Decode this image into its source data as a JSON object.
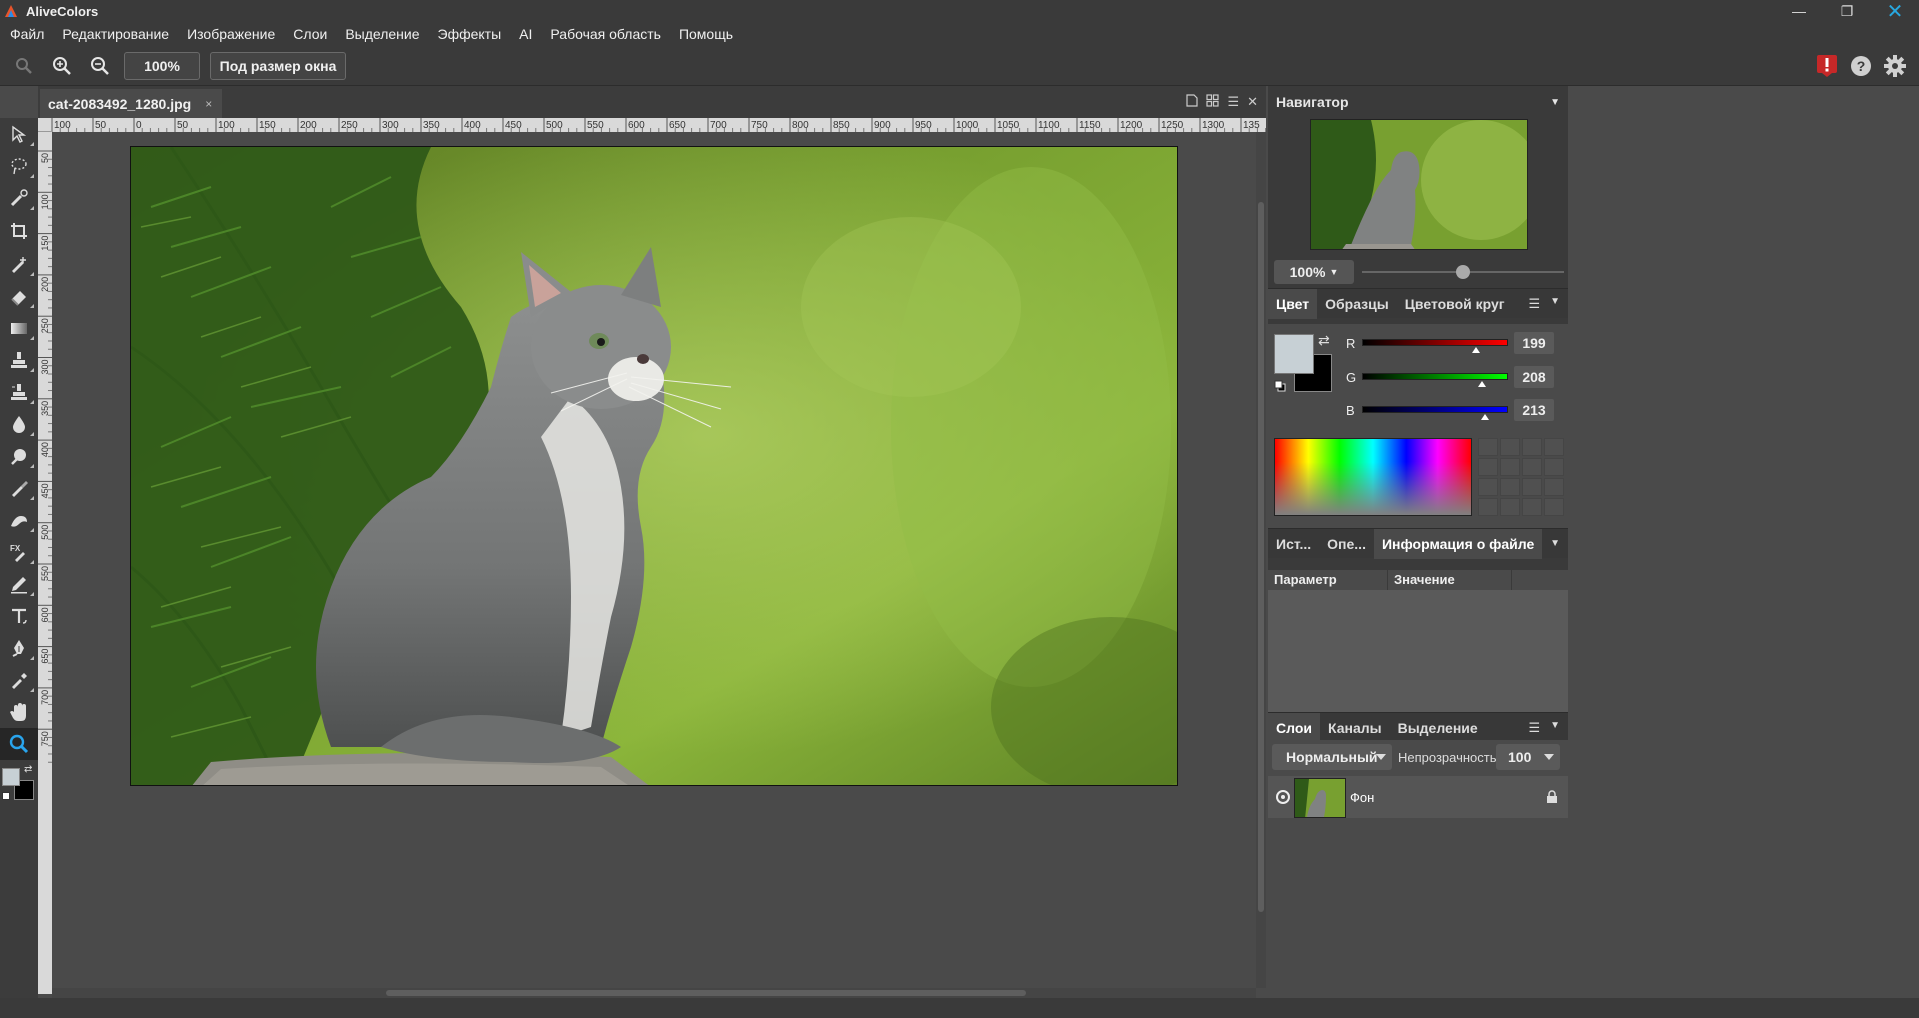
{
  "app": {
    "title": "AliveColors",
    "window_controls": [
      "minimize-icon",
      "restore-icon",
      "close-icon"
    ]
  },
  "menu": [
    "Файл",
    "Редактирование",
    "Изображение",
    "Слои",
    "Выделение",
    "Эффекты",
    "AI",
    "Рабочая область",
    "Помощь"
  ],
  "toolbar": {
    "icons": [
      "zoom-icon",
      "zoom-in-icon",
      "zoom-out-icon"
    ],
    "zoom_value": "100%",
    "fit_button": "Под размер окна",
    "right_icons": [
      "alert-icon",
      "help-icon",
      "settings-icon"
    ]
  },
  "tools": [
    "select-arrow",
    "lasso",
    "magic-brush",
    "crop",
    "brush-plus",
    "eraser",
    "gradient",
    "stamp",
    "clone-stamp",
    "drop",
    "sponge",
    "brush",
    "smudge",
    "fx-brush",
    "pencil",
    "text",
    "pen",
    "eyedropper",
    "hand",
    "zoom"
  ],
  "document": {
    "tab_name": "cat-2083492_1280.jpg",
    "tab_close": "×"
  },
  "rulers": {
    "top": [
      "100",
      "50",
      "0",
      "50",
      "100",
      "150",
      "200",
      "250",
      "300",
      "350",
      "400",
      "450",
      "500",
      "550",
      "600",
      "650",
      "700",
      "750",
      "800",
      "850",
      "900",
      "950",
      "1000",
      "1050",
      "1100",
      "1150",
      "1200",
      "1250",
      "1300",
      "135"
    ],
    "left": [
      "50",
      "100",
      "150",
      "200",
      "250",
      "300",
      "350",
      "400",
      "450",
      "500",
      "550",
      "600",
      "650",
      "700",
      "750"
    ]
  },
  "navigator": {
    "title": "Навигатор",
    "zoom": "100%",
    "zoom_fraction": 0.5
  },
  "color_panel": {
    "tabs": [
      "Цвет",
      "Образцы",
      "Цветовой круг"
    ],
    "active_tab": "Цвет",
    "foreground": "#c7d0d5",
    "background": "#000000",
    "channels": [
      {
        "label": "R",
        "value": "199",
        "fraction": 0.78,
        "color": "#ff0000"
      },
      {
        "label": "G",
        "value": "208",
        "fraction": 0.82,
        "color": "#00ff00"
      },
      {
        "label": "B",
        "value": "213",
        "fraction": 0.84,
        "color": "#0000ff"
      }
    ]
  },
  "info_panel": {
    "tabs": [
      "Ист...",
      "Опе...",
      "Информация о файле"
    ],
    "active_tab": "Информация о файле",
    "columns": [
      "Параметр",
      "Значение"
    ]
  },
  "layers_panel": {
    "tabs": [
      "Слои",
      "Каналы",
      "Выделение"
    ],
    "active_tab": "Слои",
    "blend_mode": "Нормальный",
    "opacity_label": "Непрозрачность",
    "opacity": "100",
    "layers": [
      {
        "name": "Фон",
        "visible": true,
        "locked": true
      }
    ]
  }
}
